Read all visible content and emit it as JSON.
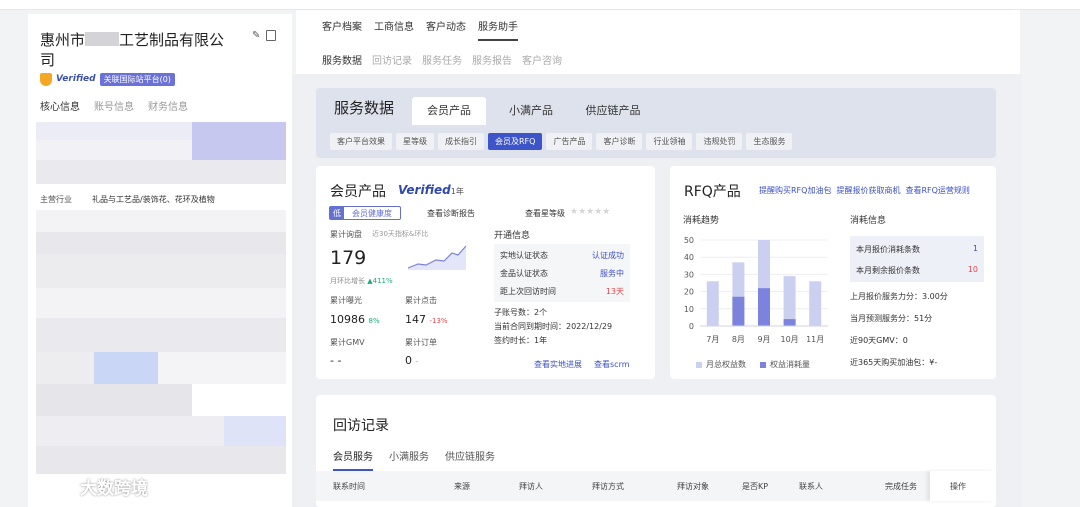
{
  "left": {
    "company_prefix": "惠州市",
    "company_suffix": "工艺制品有限公司",
    "verified": "Verified",
    "intl_link": "关联国际站平台(0)",
    "tabs": [
      "核心信息",
      "账号信息",
      "财务信息"
    ],
    "industry_label": "主营行业",
    "industry_value": "礼品与工艺品/装饰花、花环及植物",
    "watermark_brand": "大数跨境"
  },
  "nav": {
    "tabs": [
      "客户档案",
      "工商信息",
      "客户动态",
      "服务助手"
    ],
    "subtabs": [
      "服务数据",
      "回访记录",
      "服务任务",
      "服务报告",
      "客户咨询"
    ]
  },
  "service": {
    "title": "服务数据",
    "tabs": [
      "会员产品",
      "小满产品",
      "供应链产品"
    ],
    "chips": [
      "客户平台效果",
      "星等级",
      "成长指引",
      "会员及RFQ",
      "广告产品",
      "客户诊断",
      "行业领袖",
      "违规处罚",
      "生态服务"
    ]
  },
  "member": {
    "title": "会员产品",
    "verified": "Verified",
    "years": "1年",
    "health_level": "低",
    "health_label": "会员健康度",
    "diag_link": "查看诊断报告",
    "star_link": "查看星等级",
    "stars": "★★★★★",
    "inquiry_label": "累计询盘",
    "inquiry_sub": "近30天指标&环比",
    "inquiry_value": "179",
    "growth_label": "月环比增长",
    "growth_value": "411%",
    "exposure_label": "累计曝光",
    "exposure_value": "10986",
    "exposure_pct": "8%",
    "clicks_label": "累计点击",
    "clicks_value": "147",
    "clicks_pct": "-13%",
    "gmv_label": "累计GMV",
    "gmv_value": "- -",
    "orders_label": "累计订单",
    "orders_value": "0",
    "orders_suffix": "-",
    "open_title": "开通信息",
    "open_rows": [
      {
        "label": "实地认证状态",
        "value": "认证成功"
      },
      {
        "label": "金品认证状态",
        "value": "服务中"
      },
      {
        "label": "距上次回访时间",
        "value": "13天"
      }
    ],
    "sub_accounts": "子账号数：2个",
    "contract_end": "当前合同到期时间：2022/12/29",
    "sign_years": "签约时长：1年",
    "link_field": "查看实地进展",
    "link_scrm": "查看scrm"
  },
  "rfq": {
    "title": "RFQ产品",
    "links": [
      "提醒购买RFQ加油包",
      "提醒报价获取商机",
      "查看RFQ运营规则"
    ],
    "trend_label": "消耗趋势",
    "consume_label": "消耗信息",
    "rows": [
      {
        "label": "本月报价消耗条数",
        "value": "1"
      },
      {
        "label": "本月剩余报价条数",
        "value": "10"
      }
    ],
    "score_line": "上月报价服务力分：3.00分",
    "forecast_line": "当月预测服务分：51分",
    "gmv90": "近90天GMV：0",
    "fuel365": "近365天购买加油包：¥-",
    "legend_total": "月总权益数",
    "legend_used": "权益消耗量",
    "color_total": "#ccd0f0",
    "color_used": "#7c83dc"
  },
  "visit": {
    "title": "回访记录",
    "tabs": [
      "会员服务",
      "小满服务",
      "供应链服务"
    ],
    "columns": [
      "联系时间",
      "来源",
      "拜访人",
      "拜访方式",
      "拜访对象",
      "是否KP",
      "联系人",
      "完成任务",
      "操作"
    ]
  },
  "chart_data": {
    "type": "bar",
    "categories": [
      "7月",
      "8月",
      "9月",
      "10月",
      "11月"
    ],
    "ylim": [
      0,
      50
    ],
    "yticks": [
      0,
      10,
      20,
      30,
      40,
      50
    ],
    "series": [
      {
        "name": "月总权益数",
        "values": [
          26,
          37,
          50,
          29,
          26
        ]
      },
      {
        "name": "权益消耗量",
        "values": [
          0,
          17,
          22,
          4,
          0
        ]
      }
    ]
  }
}
